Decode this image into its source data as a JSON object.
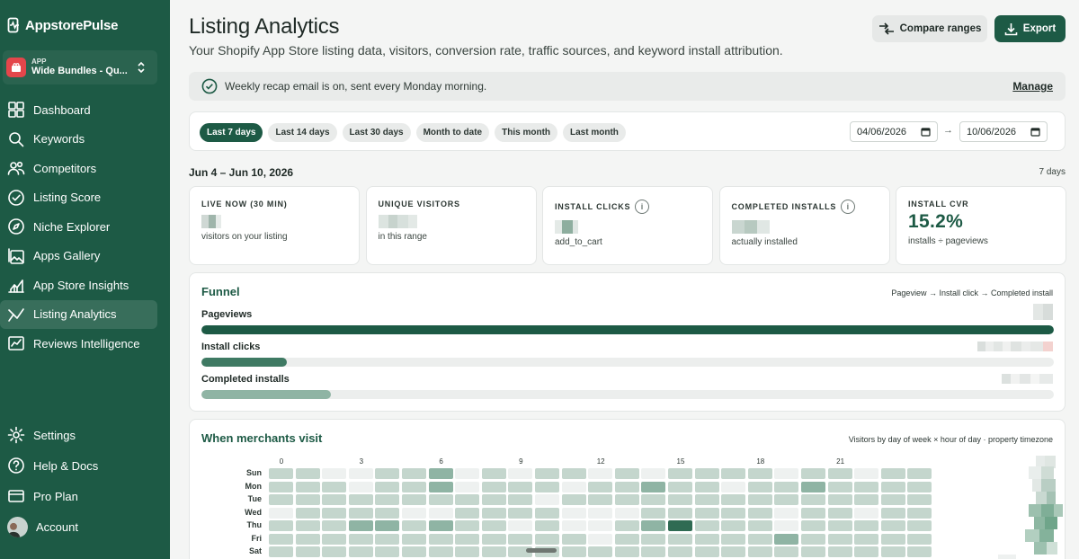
{
  "brand": {
    "name": "AppstorePulse"
  },
  "app_switcher": {
    "kicker": "APP",
    "name": "Wide Bundles - Qu..."
  },
  "nav": {
    "items": [
      {
        "label": "Dashboard",
        "icon": "dashboard-icon"
      },
      {
        "label": "Keywords",
        "icon": "search-icon"
      },
      {
        "label": "Competitors",
        "icon": "users-icon"
      },
      {
        "label": "Listing Score",
        "icon": "check-circle-icon"
      },
      {
        "label": "Niche Explorer",
        "icon": "compass-icon"
      },
      {
        "label": "Apps Gallery",
        "icon": "gallery-icon"
      },
      {
        "label": "App Store Insights",
        "icon": "chart-icon"
      },
      {
        "label": "Listing Analytics",
        "icon": "analytics-icon",
        "active": true
      },
      {
        "label": "Reviews Intelligence",
        "icon": "reviews-icon"
      }
    ],
    "bottom": [
      {
        "label": "Settings",
        "icon": "gear-icon"
      },
      {
        "label": "Help & Docs",
        "icon": "help-icon"
      },
      {
        "label": "Pro Plan",
        "icon": "card-icon"
      },
      {
        "label": "Account",
        "icon": "avatar"
      }
    ]
  },
  "header": {
    "title": "Listing Analytics",
    "subtitle": "Your Shopify App Store listing data, visitors, conversion rate, traffic sources, and keyword install attribution.",
    "compare_label": "Compare ranges",
    "export_label": "Export"
  },
  "recap": {
    "text": "Weekly recap email is on, sent every Monday morning.",
    "action": "Manage"
  },
  "range": {
    "presets": [
      "Last 7 days",
      "Last 14 days",
      "Last 30 days",
      "Month to date",
      "This month",
      "Last month"
    ],
    "active_index": 0,
    "from": "04/06/2026",
    "to": "10/06/2026",
    "arrow": "→"
  },
  "period": {
    "label": "Jun 4 – Jun 10, 2026",
    "days": "7 days"
  },
  "metrics": [
    {
      "label": "LIVE NOW (30 MIN)",
      "sub": "visitors on your listing",
      "info": false
    },
    {
      "label": "UNIQUE VISITORS",
      "sub": "in this range",
      "info": false
    },
    {
      "label": "INSTALL CLICKS",
      "sub": "add_to_cart",
      "info": true
    },
    {
      "label": "COMPLETED INSTALLS",
      "sub": "actually installed",
      "info": true
    },
    {
      "label": "INSTALL CVR",
      "value": "15.2%",
      "sub": "installs ÷ pageviews",
      "info": false
    }
  ],
  "funnel": {
    "title": "Funnel",
    "note": "Pageview → Install click → Completed install",
    "steps": [
      {
        "label": "Pageviews",
        "fraction": 1.0,
        "color": "#1d5a45"
      },
      {
        "label": "Install clicks",
        "fraction": 0.1,
        "color": "#3f7a63"
      },
      {
        "label": "Completed installs",
        "fraction": 0.152,
        "color": "#8fb4a4"
      }
    ]
  },
  "heatmap": {
    "title": "When merchants visit",
    "note": "Visitors by day of week × hour of day · property timezone",
    "days": [
      "Sun",
      "Mon",
      "Tue",
      "Wed",
      "Thu",
      "Fri",
      "Sat"
    ],
    "hour_ticks": [
      "0",
      "3",
      "6",
      "9",
      "12",
      "15",
      "18",
      "21"
    ],
    "levels": [
      [
        1,
        1,
        0,
        0,
        1,
        1,
        2,
        0,
        1,
        0,
        1,
        1,
        0,
        1,
        0,
        1,
        1,
        1,
        1,
        0,
        1,
        1,
        0,
        1,
        1
      ],
      [
        1,
        1,
        1,
        0,
        1,
        1,
        2,
        0,
        1,
        1,
        1,
        0,
        1,
        1,
        2,
        1,
        1,
        0,
        1,
        1,
        2,
        1,
        1,
        1,
        1
      ],
      [
        1,
        1,
        1,
        1,
        1,
        1,
        1,
        1,
        1,
        1,
        0,
        1,
        1,
        1,
        1,
        1,
        1,
        1,
        1,
        1,
        1,
        1,
        1,
        1,
        1
      ],
      [
        0,
        1,
        1,
        1,
        1,
        0,
        0,
        1,
        1,
        1,
        1,
        0,
        0,
        0,
        1,
        1,
        1,
        1,
        1,
        0,
        1,
        1,
        0,
        1,
        1
      ],
      [
        1,
        1,
        1,
        2,
        2,
        1,
        2,
        1,
        1,
        0,
        1,
        0,
        0,
        1,
        2,
        3,
        1,
        1,
        1,
        0,
        1,
        1,
        1,
        1,
        1
      ],
      [
        1,
        1,
        1,
        1,
        1,
        1,
        1,
        1,
        1,
        1,
        1,
        1,
        0,
        1,
        1,
        1,
        1,
        1,
        1,
        2,
        1,
        1,
        1,
        1,
        1
      ],
      [
        1,
        1,
        1,
        1,
        1,
        1,
        1,
        1,
        1,
        1,
        1,
        1,
        1,
        1,
        1,
        1,
        1,
        1,
        1,
        1,
        1,
        1,
        1,
        1,
        1
      ]
    ],
    "colors": [
      "#eef1f0",
      "#c4d6cd",
      "#8fb4a4",
      "#2f6b53"
    ]
  }
}
